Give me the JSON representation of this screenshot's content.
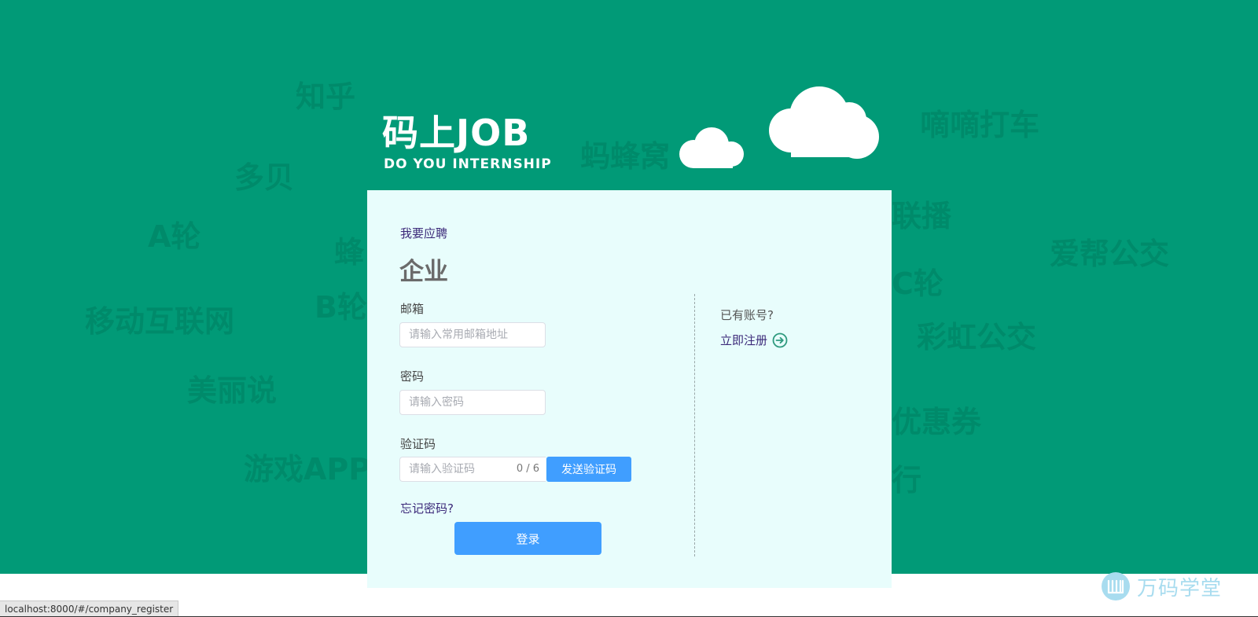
{
  "background_words": [
    "知乎",
    "多贝",
    "A轮",
    "移动互联网",
    "美丽说",
    "游戏APP",
    "B轮",
    "蜂",
    "蚂蜂窝",
    "嘀嘀打车",
    "联播",
    "爱帮公交",
    "C轮",
    "彩虹公交",
    "优惠券",
    "行"
  ],
  "logo": {
    "main": "码上JOB",
    "sub": "DO YOU INTERNSHIP"
  },
  "form": {
    "apply_link": "我要应聘",
    "role_title": "企业",
    "email_label": "邮箱",
    "email_placeholder": "请输入常用邮箱地址",
    "password_label": "密码",
    "password_placeholder": "请输入密码",
    "code_label": "验证码",
    "code_placeholder": "请输入验证码",
    "code_count": "0 / 6",
    "send_code_button": "发送验证码",
    "forgot_link": "忘记密码?",
    "login_button": "登录"
  },
  "side": {
    "has_account": "已有账号?",
    "register_link": "立即注册"
  },
  "watermark": {
    "text": "万码学堂"
  },
  "status_bar": {
    "url": "localhost:8000/#/company_register"
  },
  "colors": {
    "background_green": "#019a77",
    "card": "#e8fdfc",
    "button_blue": "#409eff",
    "link_purple": "#3c2a7a"
  },
  "icons": {
    "register_arrow": "arrow-right-circle-icon",
    "watermark_logo": "wanma-logo-icon"
  }
}
